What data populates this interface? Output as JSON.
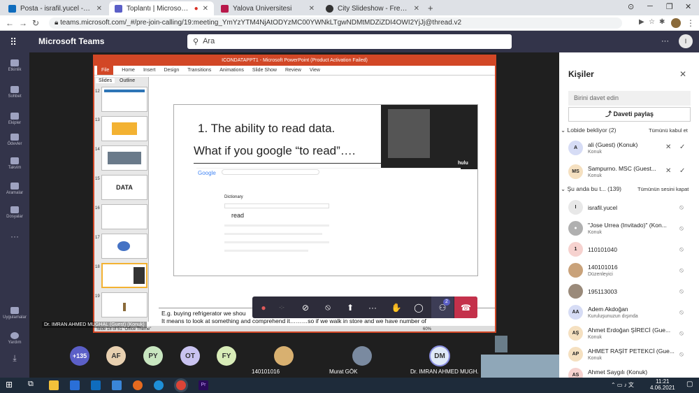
{
  "browser": {
    "tabs": [
      {
        "title": "Posta - israfil.yucel - Outlook",
        "color": "#0f6cbd"
      },
      {
        "title": "Toplantı | Microsoft Teams",
        "color": "#5b5fc7"
      },
      {
        "title": "Yalova Üniversitesi",
        "color": "#b8184a"
      },
      {
        "title": "City Slideshow - Free Premiere Pr",
        "color": "#333"
      }
    ],
    "new_tab": "+",
    "url": "teams.microsoft.com/_#/pre-join-calling/19:meeting_YmYzYTM4NjAtODYzMC00YWNkLTgwNDMtMDZiZDI4OWI2YjJj@thread.v2"
  },
  "teams": {
    "app_title": "Microsoft Teams",
    "search_placeholder": "Ara",
    "rail": [
      "Etkinlik",
      "Sohbet",
      "Ekipler",
      "Ödevler",
      "Takvim",
      "Aramalar",
      "Dosyalar",
      "Uygulamalar",
      "Yardım"
    ]
  },
  "ppt": {
    "window_title": "ICONDATAPPT1 - Microsoft PowerPoint (Product Activation Failed)",
    "file_tab": "File",
    "ribbon_tabs": [
      "Home",
      "Insert",
      "Design",
      "Transitions",
      "Animations",
      "Slide Show",
      "Review",
      "View"
    ],
    "panel_tabs": [
      "Slides",
      "Outline"
    ],
    "thumb_numbers": [
      "12",
      "13",
      "14",
      "15",
      "16",
      "17",
      "18",
      "19"
    ],
    "slide_line1": "1. The ability to read data.",
    "slide_line2": "What if you google “to read”….",
    "google_word": "Google",
    "dictionary": "Dictionary",
    "read_word": "read",
    "hulu": "hulu",
    "data_thumb": "DATA",
    "notes_line1": "E.g. buying refrigerator we shou",
    "notes_line2": "It means to look at something and comprehend it………so if we walk in store and we have number of",
    "status": "Slide 18 of 51   \"Office Theme\"",
    "zoom": "60%"
  },
  "meeting": {
    "presenter_label": "Dr. IMRAN AHMED MUGHAL (Guest) (Konuk)",
    "reactions_badge": "2",
    "strip": [
      {
        "initials": "+135",
        "color": "#5b5fc7"
      },
      {
        "initials": "AF",
        "color": "#e8d0b0"
      },
      {
        "initials": "PY",
        "color": "#c8e6c0"
      },
      {
        "initials": "OT",
        "color": "#c9c3f0"
      },
      {
        "initials": "FY",
        "color": "#d8ecb8"
      }
    ],
    "video_tiles": [
      {
        "name": "140101016"
      },
      {
        "name": "Murat GÖK"
      },
      {
        "name": "Dr. IMRAN AHMED MUGH...",
        "initials": "DM"
      }
    ]
  },
  "panel": {
    "title": "Kişiler",
    "invite_placeholder": "Birini davet edin",
    "share_invite": "Daveti paylaş",
    "lobby_label": "Lobide bekliyor",
    "lobby_count": "(2)",
    "accept_all": "Tümünü kabul et",
    "lobby": [
      {
        "initials": "A",
        "name": "ali (Guest) (Konuk)",
        "sub": "Konuk",
        "color": "#d6dcf5"
      },
      {
        "initials": "MS",
        "name": "Sampurno. MSC (Guest...",
        "sub": "Konuk",
        "color": "#f5e0c0"
      }
    ],
    "in_meeting_label": "Şu anda bu t...",
    "in_meeting_count": "(139)",
    "mute_all": "Tümünün sesini kapat",
    "people": [
      {
        "initials": "I",
        "name": "israfil.yucel",
        "sub": "",
        "color": "#e8e8e8"
      },
      {
        "initials": "",
        "name": "\"Jose Urrea (Invitado)\" (Kon...",
        "sub": "Konuk",
        "color": "#b0b0b0"
      },
      {
        "initials": "1",
        "name": "110101040",
        "sub": "",
        "color": "#f6d2cf"
      },
      {
        "initials": "",
        "name": "140101016",
        "sub": "Düzenleyici",
        "color": "#c9a27a"
      },
      {
        "initials": "",
        "name": "195113003",
        "sub": "",
        "color": "#9a8a7a"
      },
      {
        "initials": "AA",
        "name": "Adem Akdoğan",
        "sub": "Kuruluşunuzun dışında",
        "color": "#d6dcf5"
      },
      {
        "initials": "AŞ",
        "name": "Ahmet Erdoğan ŞİRECİ (Gue...",
        "sub": "Konuk",
        "color": "#f5e0c0"
      },
      {
        "initials": "AP",
        "name": "AHMET RAŞİT PETEKCİ (Gue...",
        "sub": "Konuk",
        "color": "#f5e0c0"
      },
      {
        "initials": "AS",
        "name": "Ahmet Saygılı (Konuk)",
        "sub": "",
        "color": "#f6d2cf"
      }
    ]
  },
  "taskbar": {
    "time": "11:21",
    "date": "4.06.2021"
  }
}
